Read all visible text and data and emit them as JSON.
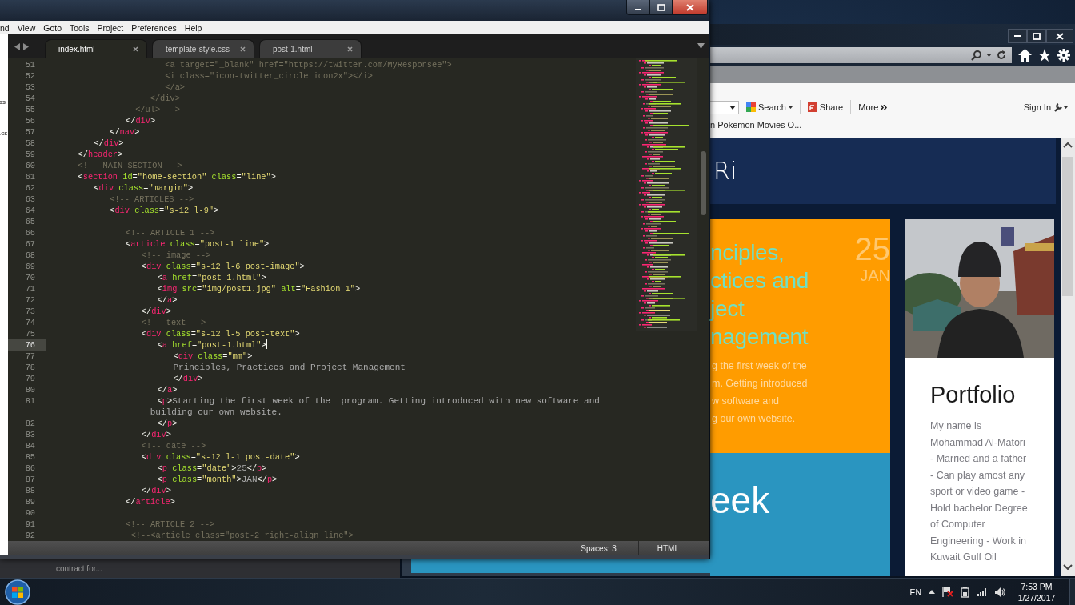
{
  "editor": {
    "menu": [
      "nd",
      "View",
      "Goto",
      "Tools",
      "Project",
      "Preferences",
      "Help"
    ],
    "sidebar_items": [
      "ss",
      ".cs"
    ],
    "tabs": [
      {
        "label": "index.html",
        "selected": true
      },
      {
        "label": "template-style.css",
        "selected": false
      },
      {
        "label": "post-1.html",
        "selected": false
      }
    ],
    "lines": [
      {
        "number": "51",
        "kind": "comment",
        "current": false,
        "text": "                        <a target=\"_blank\" href=\"https://twitter.com/MyResponsee\">"
      },
      {
        "number": "52",
        "kind": "comment",
        "current": false,
        "text": "                        <i class=\"icon-twitter_circle icon2x\"></i>"
      },
      {
        "number": "53",
        "kind": "comment",
        "current": false,
        "text": "                        </a>"
      },
      {
        "number": "54",
        "kind": "comment",
        "current": false,
        "text": "                     </div>"
      },
      {
        "number": "55",
        "kind": "comment",
        "current": false,
        "text": "                  </ul> -->"
      },
      {
        "number": "56",
        "kind": "code",
        "current": false,
        "text": "               </div>"
      },
      {
        "number": "57",
        "kind": "code",
        "current": false,
        "text": "            </nav>"
      },
      {
        "number": "58",
        "kind": "code",
        "current": false,
        "text": "         </div>"
      },
      {
        "number": "59",
        "kind": "code",
        "current": false,
        "text": "      </header>"
      },
      {
        "number": "60",
        "kind": "code",
        "current": false,
        "text": "      <!-- MAIN SECTION -->"
      },
      {
        "number": "61",
        "kind": "code",
        "current": false,
        "text": "      <section id=\"home-section\" class=\"line\">"
      },
      {
        "number": "62",
        "kind": "code",
        "current": false,
        "text": "         <div class=\"margin\">"
      },
      {
        "number": "63",
        "kind": "code",
        "current": false,
        "text": "            <!-- ARTICLES -->"
      },
      {
        "number": "64",
        "kind": "code",
        "current": false,
        "text": "            <div class=\"s-12 l-9\">"
      },
      {
        "number": "65",
        "current": false
      },
      {
        "number": "66",
        "kind": "code",
        "current": false,
        "text": "               <!-- ARTICLE 1 -->"
      },
      {
        "number": "67",
        "kind": "code",
        "current": false,
        "text": "               <article class=\"post-1 line\">"
      },
      {
        "number": "68",
        "kind": "code",
        "current": false,
        "text": "                  <!-- image -->"
      },
      {
        "number": "69",
        "kind": "code",
        "current": false,
        "text": "                  <div class=\"s-12 l-6 post-image\">"
      },
      {
        "number": "70",
        "kind": "code",
        "current": false,
        "text": "                     <a href=\"post-1.html\">"
      },
      {
        "number": "71",
        "kind": "code",
        "current": false,
        "text": "                     <img src=\"img/post1.jpg\" alt=\"Fashion 1\">"
      },
      {
        "number": "72",
        "kind": "code",
        "current": false,
        "text": "                     </a>"
      },
      {
        "number": "73",
        "kind": "code",
        "current": false,
        "text": "                  </div>"
      },
      {
        "number": "74",
        "kind": "code",
        "current": false,
        "text": "                  <!-- text -->"
      },
      {
        "number": "75",
        "kind": "code",
        "current": false,
        "text": "                  <div class=\"s-12 l-5 post-text\">"
      },
      {
        "number": "76",
        "kind": "code",
        "current": true,
        "text": "                     <a href=\"post-1.html\">"
      },
      {
        "number": "77",
        "kind": "code",
        "current": false,
        "text": "                        <div class=\"mm\">"
      },
      {
        "number": "78",
        "kind": "code",
        "current": false,
        "text": "                        Principles, Practices and Project Management"
      },
      {
        "number": "79",
        "kind": "code",
        "current": false,
        "text": "                        </div>"
      },
      {
        "number": "80",
        "kind": "code",
        "current": false,
        "text": "                     </a>"
      },
      {
        "number": "81",
        "kind": "code",
        "current": false,
        "text": "                     <p>Starting the first week of the  program. Getting introduced with new software and building our own website."
      },
      {
        "number": "82",
        "kind": "code",
        "current": false,
        "text": "                     </p>"
      },
      {
        "number": "83",
        "kind": "code",
        "current": false,
        "text": "                  </div>"
      },
      {
        "number": "84",
        "kind": "code",
        "current": false,
        "text": "                  <!-- date -->"
      },
      {
        "number": "85",
        "kind": "code",
        "current": false,
        "text": "                  <div class=\"s-12 l-1 post-date\">"
      },
      {
        "number": "86",
        "kind": "code",
        "current": false,
        "text": "                     <p class=\"date\">25</p>"
      },
      {
        "number": "87",
        "kind": "code",
        "current": false,
        "text": "                     <p class=\"month\">JAN</p>"
      },
      {
        "number": "88",
        "kind": "code",
        "current": false,
        "text": "                  </div>"
      },
      {
        "number": "89",
        "kind": "code",
        "current": false,
        "text": "               </article>"
      },
      {
        "number": "90",
        "current": false
      },
      {
        "number": "91",
        "kind": "code",
        "current": false,
        "text": "               <!-- ARTICLE 2 -->"
      },
      {
        "number": "92",
        "kind": "code",
        "current": false,
        "text": "                <!--<article class=\"post-2 right-align line\">"
      }
    ],
    "status_bar": {
      "indentation": "Spaces: 3",
      "syntax": "HTML"
    }
  },
  "background_window": {
    "text": "contract for..."
  },
  "browser": {
    "toolbar": {
      "search": "Search",
      "share": "Share",
      "more": "More",
      "sign_in": "Sign In"
    },
    "favorites": [
      "n Pokemon Movies O..."
    ],
    "page": {
      "header": "Ri",
      "post": {
        "title": "nciples,\nctices and\nject\nnagement",
        "day": "25",
        "month": "JAN",
        "excerpt": "g the first week of the\nm. Getting introduced\nw software and\ng our own website."
      },
      "next_post": {
        "title": "eek"
      },
      "profile": {
        "title": "Portfolio",
        "bio": "My name is\nMohammad Al-Matori\n- Married and a father\n- Can play amost any\nsport or video game -\nHold bachelor Degree\nof Computer\nEngineering - Work in\nKuwait Gulf Oil"
      }
    }
  },
  "taskbar": {
    "language": "EN",
    "time": "7:53 PM",
    "date": "1/27/2017"
  }
}
